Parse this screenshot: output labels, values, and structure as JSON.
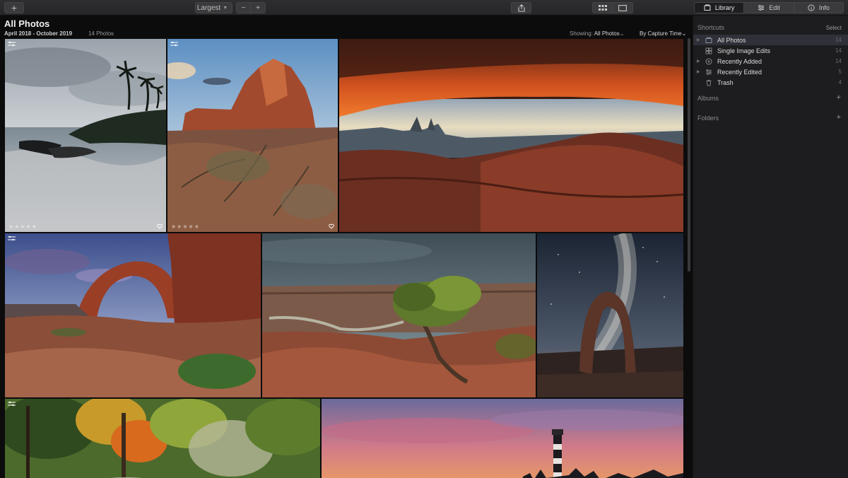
{
  "toolbar": {
    "add_label": "+",
    "size_label": "Largest",
    "zoom_out_label": "−",
    "zoom_in_label": "+",
    "tabs": [
      {
        "label": "Library",
        "icon": "library-icon"
      },
      {
        "label": "Edit",
        "icon": "sliders-icon"
      },
      {
        "label": "Info",
        "icon": "info-icon"
      }
    ]
  },
  "header": {
    "title": "All Photos",
    "date_range": "April 2018 - October 2019",
    "count": "14 Photos",
    "showing_label": "Showing:",
    "showing_value": "All Photos",
    "sort_label": "By Capture Time"
  },
  "sidebar": {
    "shortcuts_label": "Shortcuts",
    "select_label": "Select",
    "items": [
      {
        "label": "All Photos",
        "count": "14",
        "icon": "photos-icon"
      },
      {
        "label": "Single Image Edits",
        "count": "14",
        "icon": "grid-icon"
      },
      {
        "label": "Recently Added",
        "count": "14",
        "icon": "plus-circle-icon"
      },
      {
        "label": "Recently Edited",
        "count": "5",
        "icon": "sliders-icon"
      },
      {
        "label": "Trash",
        "count": "4",
        "icon": "trash-icon"
      }
    ],
    "albums_label": "Albums",
    "folders_label": "Folders"
  },
  "photos": [
    {
      "subject": "beach-palms",
      "rating": "★★★★★"
    },
    {
      "subject": "red-rock-tower",
      "rating": "★★★★★"
    },
    {
      "subject": "mesa-arch"
    },
    {
      "subject": "rock-arch"
    },
    {
      "subject": "canyon-tree"
    },
    {
      "subject": "delicate-arch-milky-way"
    },
    {
      "subject": "autumn-forest"
    },
    {
      "subject": "lighthouse-sunset"
    }
  ]
}
